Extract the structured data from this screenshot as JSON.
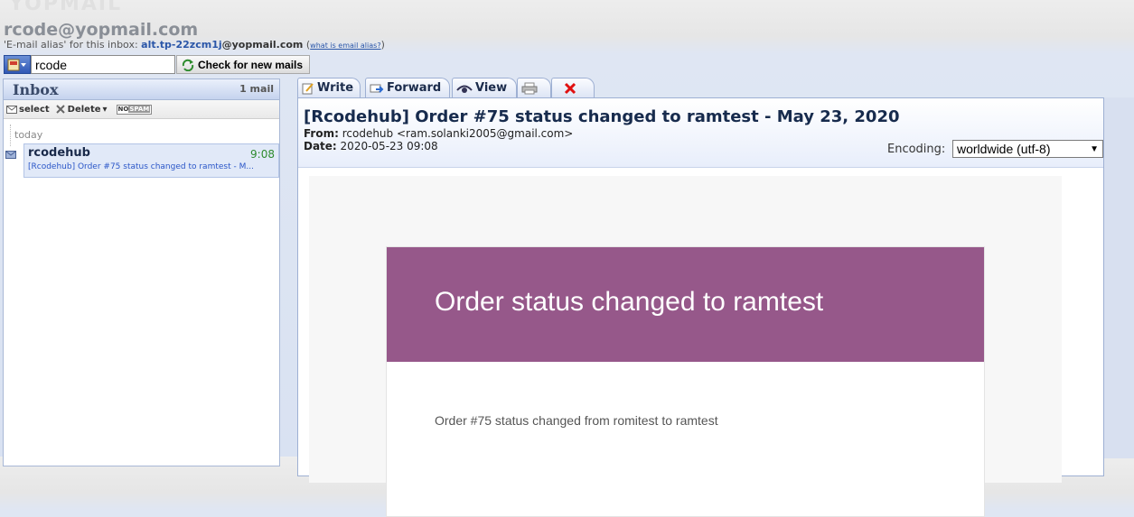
{
  "header": {
    "logo_ghost": "YOPMAIL",
    "inbox_email": "rcode@yopmail.com",
    "alias_prefix": "'E-mail alias' for this inbox: ",
    "alias_value": "alt.tp-22zcm1j",
    "alias_domain": "@yopmail.com",
    "alias_help_open": "(",
    "alias_help_link": "what is email alias?",
    "alias_help_close": ")"
  },
  "login": {
    "value": "rcode",
    "check_button": "Check for new mails"
  },
  "inbox": {
    "title": "Inbox",
    "count": "1 mail",
    "tools": {
      "select": "select",
      "delete": "Delete",
      "nospam_no": "NO",
      "nospam_spam": "SPAM"
    },
    "group_label": "today",
    "items": [
      {
        "sender": "rcodehub",
        "time": "9:08",
        "subject": "[Rcodehub] Order #75 status changed to ramtest - M..."
      }
    ]
  },
  "tabs": {
    "write": "Write",
    "forward": "Forward",
    "view": "View"
  },
  "message": {
    "subject": "[Rcodehub] Order #75 status changed to ramtest - May 23, 2020",
    "from_label": "From:",
    "from_value": " rcodehub <ram.solanki2005@gmail.com>",
    "date_label": "Date:",
    "date_value": " 2020-05-23 09:08",
    "encoding_label": "Encoding:",
    "encoding_value": "worldwide (utf-8)",
    "body": {
      "heading": "Order status changed to ramtest",
      "text": "Order #75 status changed from romitest to ramtest"
    }
  },
  "colors": {
    "banner": "#96588a",
    "time_green": "#2e8b2e",
    "link_blue": "#2a56a8",
    "delete_red": "#e01010"
  }
}
